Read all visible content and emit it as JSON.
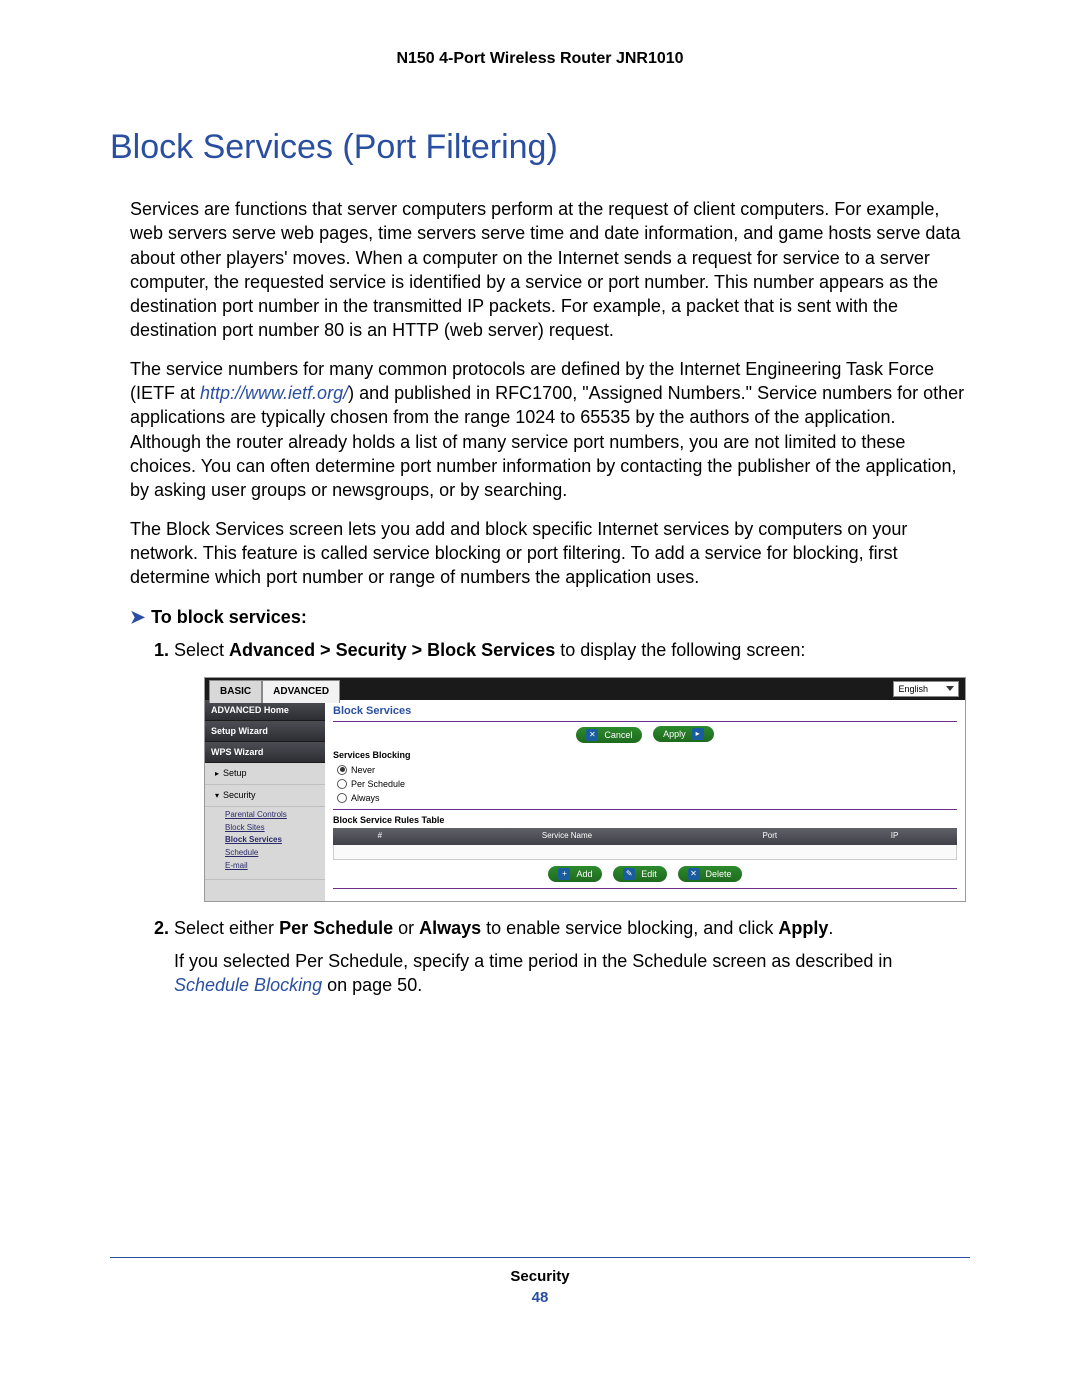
{
  "doc_header": "N150 4-Port Wireless Router JNR1010",
  "title": "Block Services (Port Filtering)",
  "para1": "Services are functions that server computers perform at the request of client computers. For example, web servers serve web pages, time servers serve time and date information, and game hosts serve data about other players' moves. When a computer on the Internet sends a request for service to a server computer, the requested service is identified by a service or port number. This number appears as the destination port number in the transmitted IP packets. For example, a packet that is sent with the destination port number 80 is an HTTP (web server) request.",
  "para2_a": "The service numbers for many common protocols are defined by the Internet Engineering Task Force (IETF at ",
  "para2_link": "http://www.ietf.org/",
  "para2_b": ") and published in RFC1700, \"Assigned Numbers.\" Service numbers for other applications are typically chosen from the range 1024 to 65535 by the authors of the application. Although the router already holds a list of many service port numbers, you are not limited to these choices. You can often determine port number information by contacting the publisher of the application, by asking user groups or newsgroups, or by searching.",
  "para3": "The Block Services screen lets you add and block specific Internet services by computers on your network. This feature is called service blocking or port filtering. To add a service for blocking, first determine which port number or range of numbers the application uses.",
  "subheading": "To block services:",
  "step1_a": "Select ",
  "step1_b_bold": "Advanced > Security > Block Services",
  "step1_c": " to display the following screen:",
  "step2_a": "Select either ",
  "step2_b1": "Per Schedule",
  "step2_mid": " or ",
  "step2_b2": "Always",
  "step2_c": " to enable service blocking, and click ",
  "step2_d": "Apply",
  "step2_e": ".",
  "step2_note_a": "If you selected Per Schedule, specify a time period in the Schedule screen as described in ",
  "step2_note_link": "Schedule Blocking",
  "step2_note_b": " on page 50.",
  "shot": {
    "tab_basic": "BASIC",
    "tab_advanced": "ADVANCED",
    "lang": "English",
    "nav": {
      "adv_home": "ADVANCED Home",
      "setup_wiz": "Setup Wizard",
      "wps_wiz": "WPS Wizard",
      "setup": "Setup",
      "security": "Security",
      "sec_items": {
        "parental": "Parental Controls",
        "block_sites": "Block Sites",
        "block_services": "Block Services",
        "schedule": "Schedule",
        "email": "E-mail"
      }
    },
    "panel_title": "Block Services",
    "btn_cancel": "Cancel",
    "btn_apply": "Apply",
    "services_blocking": "Services Blocking",
    "opt_never": "Never",
    "opt_per_schedule": "Per Schedule",
    "opt_always": "Always",
    "rules_table_title": "Block Service Rules Table",
    "th_num": "#",
    "th_service": "Service Name",
    "th_port": "Port",
    "th_ip": "IP",
    "btn_add": "Add",
    "btn_edit": "Edit",
    "btn_delete": "Delete"
  },
  "footer_chapter": "Security",
  "footer_page": "48"
}
